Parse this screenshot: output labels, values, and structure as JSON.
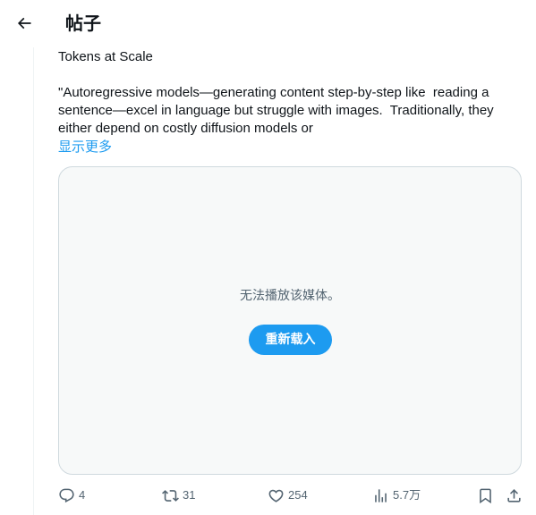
{
  "header": {
    "title": "帖子",
    "back_icon": "arrow-left-icon"
  },
  "post": {
    "title_line": "Tokens at Scale",
    "body": "\"Autoregressive models—generating content step-by-step like  reading a sentence—excel in language but struggle with images.  Traditionally, they either depend on costly diffusion models or",
    "show_more": "显示更多"
  },
  "media": {
    "message": "无法播放该媒体。",
    "reload_label": "重新载入"
  },
  "actions": {
    "reply_count": "4",
    "repost_count": "31",
    "like_count": "254",
    "views_count": "5.7万"
  },
  "colors": {
    "accent": "#1d9bf0",
    "text": "#0f1419",
    "secondary": "#536471",
    "border": "#cfd9de",
    "media_bg": "#f7f9f9"
  }
}
